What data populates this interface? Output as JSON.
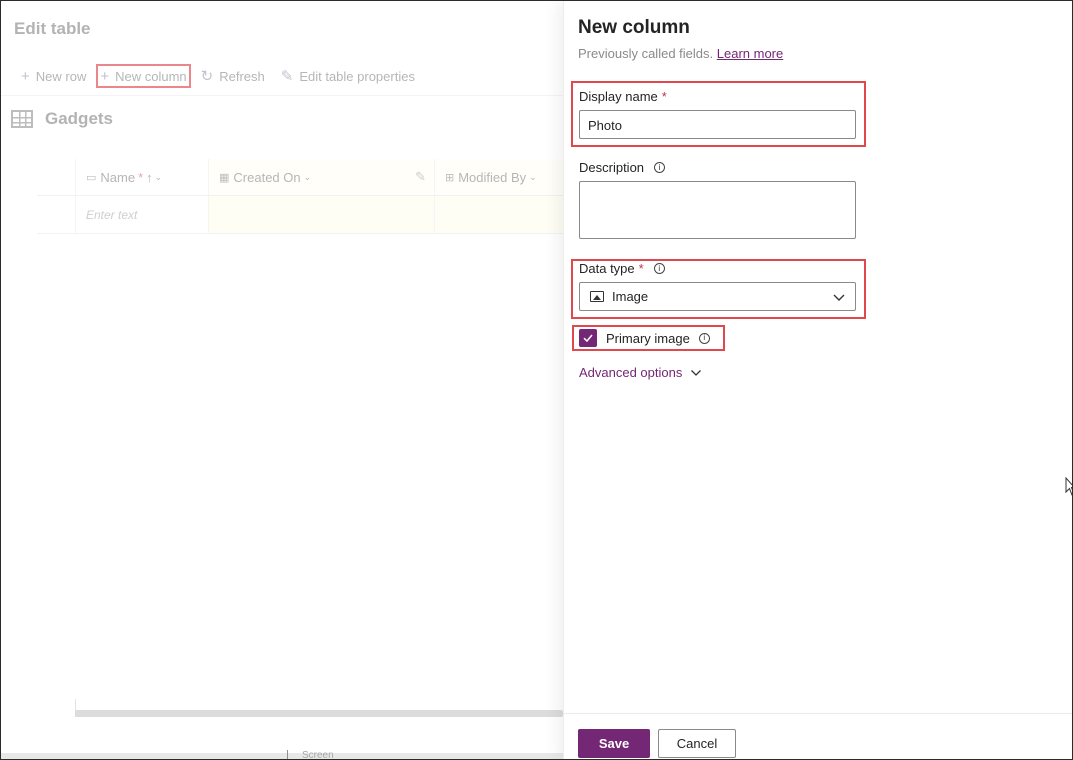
{
  "background": {
    "page_title": "Edit table",
    "toolbar": {
      "new_row": "New row",
      "new_column": "New column",
      "refresh": "Refresh",
      "edit_table_properties": "Edit table properties"
    },
    "table_name": "Gadgets",
    "columns": [
      {
        "label": "Name",
        "required": "*",
        "sort": "↑",
        "icon": "text-field-icon"
      },
      {
        "label": "Created On",
        "icon": "calendar-icon"
      },
      {
        "label": "Modified By",
        "icon": "lookup-icon"
      }
    ],
    "new_row_placeholder": "Enter text",
    "bottom_label": "Screen"
  },
  "panel": {
    "title": "New column",
    "subtitle": "Previously called fields.",
    "learn_more": "Learn more",
    "display_name": {
      "label": "Display name",
      "required": "*",
      "value": "Photo"
    },
    "description": {
      "label": "Description",
      "info": "i",
      "value": ""
    },
    "data_type": {
      "label": "Data type",
      "required": "*",
      "info": "i",
      "value": "Image",
      "icon": "image-icon"
    },
    "primary_image": {
      "label": "Primary image",
      "checked": true,
      "info": "i"
    },
    "advanced_options": "Advanced options",
    "save": "Save",
    "cancel": "Cancel"
  },
  "colors": {
    "accent": "#742774",
    "highlight": "#e0484e",
    "required_star": "#c4314b"
  }
}
